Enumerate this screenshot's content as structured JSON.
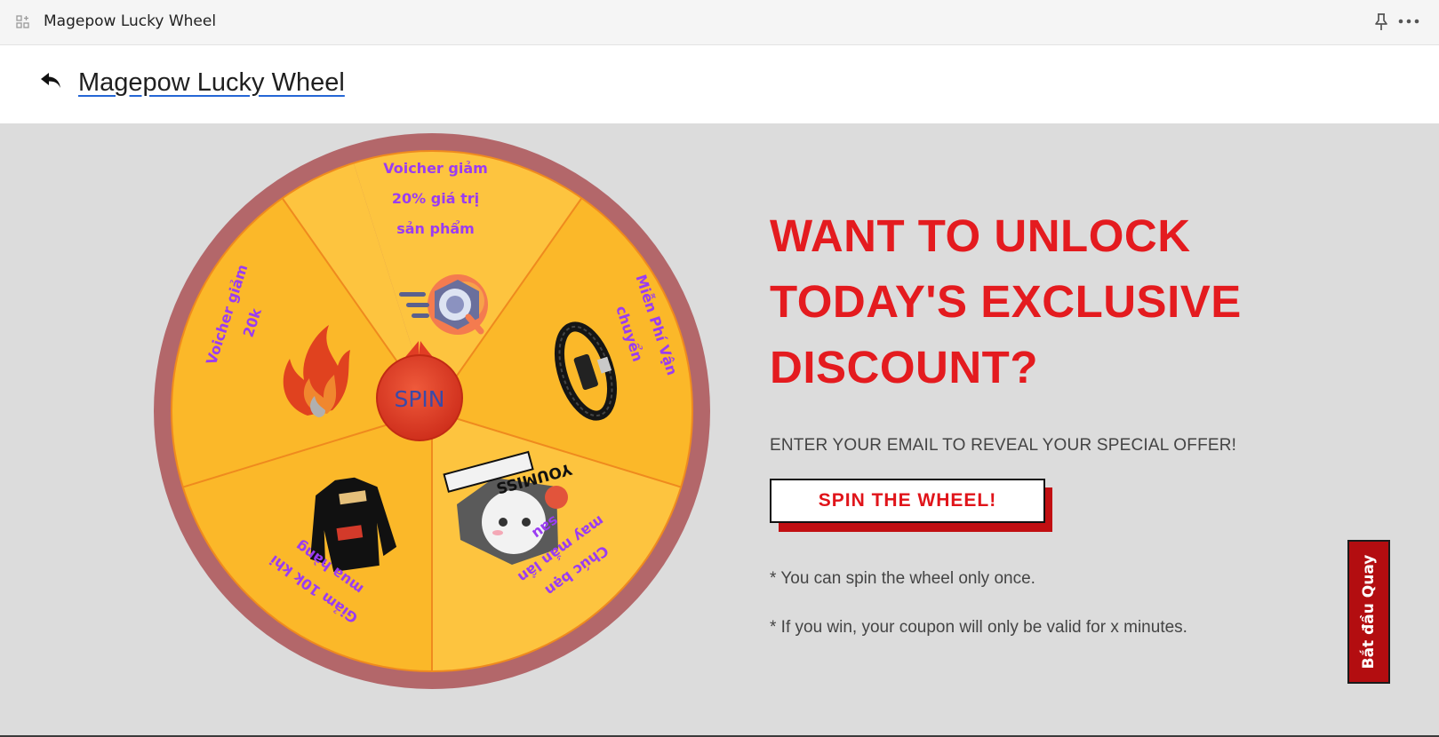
{
  "window": {
    "title": "Magepow Lucky Wheel",
    "app_icon": "app-grid-icon",
    "pin_icon": "pin-icon",
    "more_icon": "more-horizontal-icon"
  },
  "header": {
    "back_icon": "back-arrow-icon",
    "title": "Magepow Lucky Wheel"
  },
  "wheel": {
    "center_label": "SPIN",
    "segments": [
      {
        "label": "Voicher giảm\n20% giá trị\nsản phẩm",
        "icon": "search-app-logo-icon"
      },
      {
        "label": "Miễn Phí Vận\nchuyển",
        "icon": "leather-bracelet-image"
      },
      {
        "label": "Chúc bạn\nmay mắn lần\nsau",
        "icon": "you-miss-sticker-image"
      },
      {
        "label": "Giảm 10k khi\nmua hàng",
        "icon": "black-hoodie-image"
      },
      {
        "label": "Voicher giảm\n20k",
        "icon": "flame-icon"
      }
    ],
    "colors": {
      "rim": "#b3676a",
      "segment_light": "#fdc43f",
      "segment_dark": "#fbb829",
      "divider": "#ef8a1e",
      "spin": "#e13d24",
      "label": "#9a3cf2"
    }
  },
  "promo": {
    "headline_lines": [
      "WANT TO UNLOCK",
      "TODAY'S EXCLUSIVE",
      "DISCOUNT?"
    ],
    "subline": "ENTER YOUR EMAIL TO REVEAL YOUR SPECIAL OFFER!",
    "spin_button": "SPIN THE WHEEL!",
    "note1": "* You can spin the wheel only once.",
    "note2": "* If you win, your coupon will only be valid for x minutes."
  },
  "side_tab": {
    "label": "Bắt đầu Quay"
  }
}
